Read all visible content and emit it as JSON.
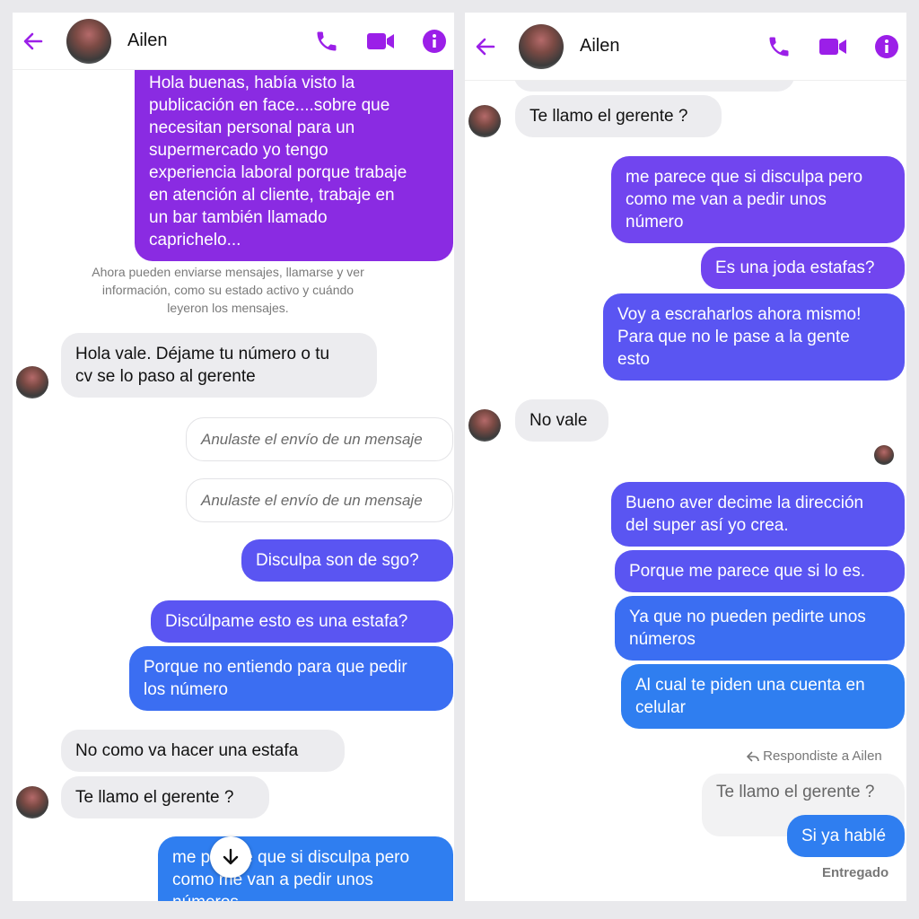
{
  "colors": {
    "accent": "#8a2be2",
    "header_icon": "#9b1fe8"
  },
  "left": {
    "header": {
      "name": "Ailen"
    },
    "messages": {
      "m1": [
        "Hola buenas, había visto la",
        "publicación en face....sobre que",
        "necesitan personal para un",
        "supermercado yo tengo",
        "experiencia laboral porque trabaje",
        "en atención al cliente, trabaje en",
        "un bar también llamado",
        "caprichelo..."
      ],
      "notice": [
        "Ahora pueden enviarse mensajes, llamarse y ver",
        "información, como su estado activo y cuándo",
        "leyeron los mensajes."
      ],
      "m2": [
        "Hola vale. Déjame tu número o tu",
        "cv se lo paso al gerente"
      ],
      "unsent1": "Anulaste el envío de un mensaje",
      "unsent2": "Anulaste el envío de un mensaje",
      "m3": "Disculpa son de sgo?",
      "m4": "Discúlpame esto es una estafa?",
      "m5": [
        "Porque no entiendo para que pedir",
        "los número"
      ],
      "m6": "No como va hacer una estafa",
      "m7": "Te llamo el gerente ?",
      "m8": [
        "me parece que si disculpa pero",
        "como me van a pedir unos",
        "números"
      ]
    }
  },
  "right": {
    "header": {
      "name": "Ailen"
    },
    "messages": {
      "r1": "Te llamo el gerente ?",
      "r2": [
        "me parece que si disculpa pero",
        "como me van a pedir unos",
        "número"
      ],
      "r3": "Es una joda estafas?",
      "r4": [
        "Voy a escraharlos ahora mismo!",
        "Para que no le pase a la gente",
        "esto"
      ],
      "r5": "No vale",
      "r6": [
        "Bueno aver decime la dirección",
        "del super así yo crea."
      ],
      "r7": "Porque me parece que si lo es.",
      "r8": [
        "Ya que no pueden pedirte unos",
        "números"
      ],
      "r9": [
        "Al cual te piden una cuenta en",
        "celular"
      ],
      "reply_note": "Respondiste a Ailen",
      "quoted": "Te llamo el gerente ?",
      "r10": "Si ya hablé",
      "status": "Entregado"
    }
  }
}
